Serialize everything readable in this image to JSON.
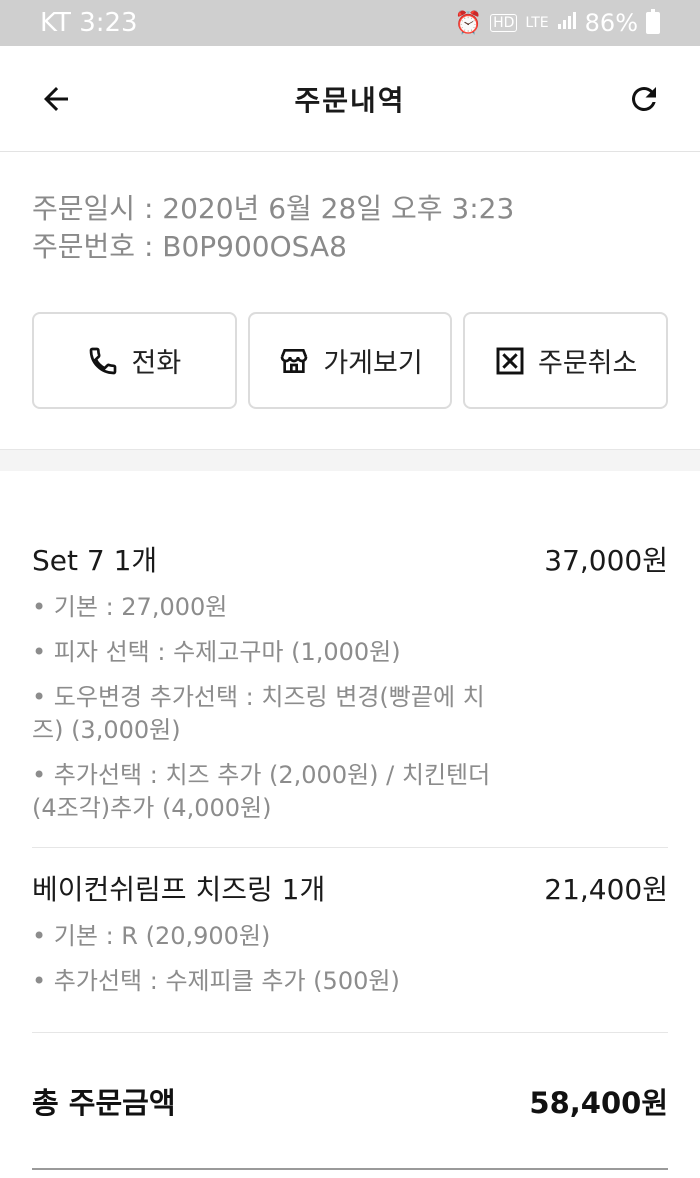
{
  "status_bar": {
    "carrier": "KT",
    "time": "3:23",
    "hd": "HD",
    "network": "LTE",
    "battery": "86%"
  },
  "app_bar": {
    "title": "주문내역",
    "back_icon": "arrow-left-icon",
    "refresh_icon": "refresh-icon"
  },
  "order_info": {
    "date_line": "주문일시 : 2020년 6월 28일 오후 3:23",
    "number_line": "주문번호 : B0P900OSA8"
  },
  "actions": [
    {
      "label": "전화",
      "icon": "phone-icon"
    },
    {
      "label": "가게보기",
      "icon": "store-icon"
    },
    {
      "label": "주문취소",
      "icon": "cancel-box-icon"
    }
  ],
  "items": [
    {
      "name": "Set 7 1개",
      "price": "37,000원",
      "options": [
        "• 기본 : 27,000원",
        "• 피자 선택 : 수제고구마 (1,000원)",
        "• 도우변경 추가선택 : 치즈링 변경(빵끝에 치즈) (3,000원)",
        "• 추가선택 : 치즈 추가 (2,000원) / 치킨텐더(4조각)추가 (4,000원)"
      ]
    },
    {
      "name": "베이컨쉬림프 치즈링 1개",
      "price": "21,400원",
      "options": [
        "• 기본 : R (20,900원)",
        "• 추가선택 : 수제피클 추가 (500원)"
      ]
    }
  ],
  "total": {
    "label": "총 주문금액",
    "value": "58,400원"
  },
  "colors": {
    "status_bar_bg": "#cfcfcf",
    "secondary_text": "#8a8a8a",
    "border": "#dcdcdc"
  }
}
